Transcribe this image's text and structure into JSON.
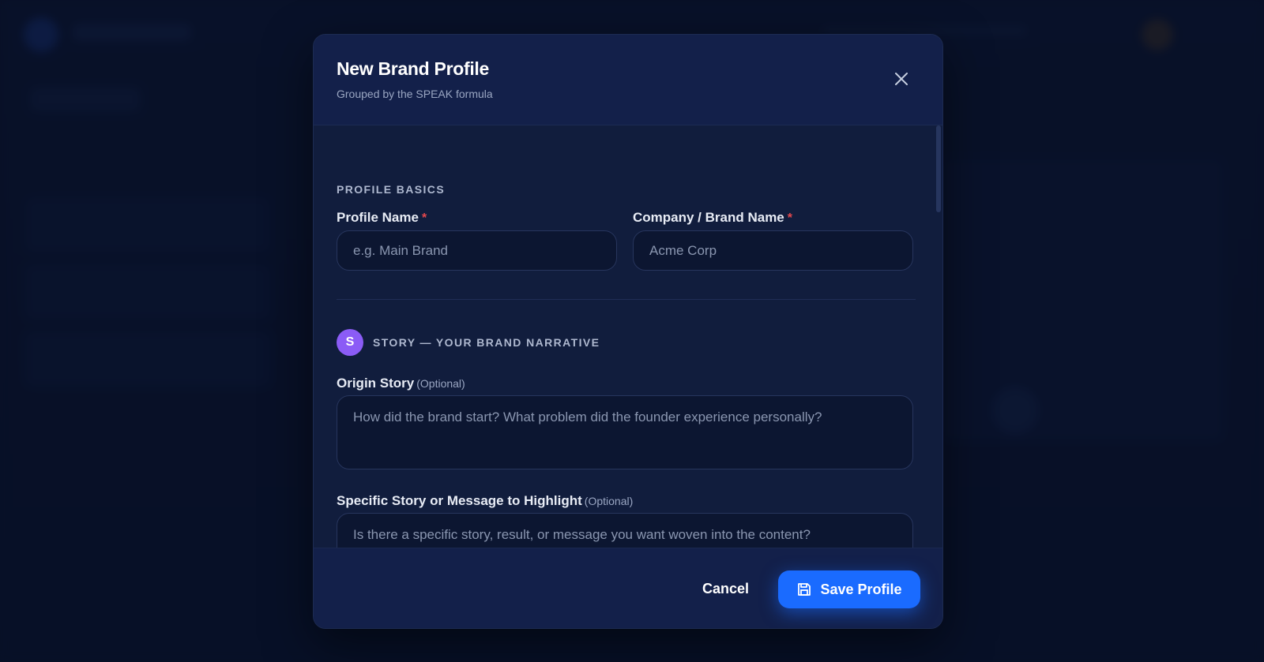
{
  "modal": {
    "title": "New Brand Profile",
    "subtitle": "Grouped by the SPEAK formula",
    "close_icon": "close-icon"
  },
  "basics": {
    "section_label": "PROFILE BASICS",
    "profile_name": {
      "label": "Profile Name",
      "required": "*",
      "placeholder": "e.g. Main Brand",
      "value": ""
    },
    "company_name": {
      "label": "Company / Brand Name",
      "required": "*",
      "placeholder": "Acme Corp",
      "value": ""
    }
  },
  "story": {
    "badge": "S",
    "badge_color": "#8b5cf6",
    "section_label": "STORY — YOUR BRAND NARRATIVE",
    "origin": {
      "label": "Origin Story",
      "optional": "(Optional)",
      "placeholder": "How did the brand start? What problem did the founder experience personally?"
    },
    "specific": {
      "label": "Specific Story or Message to Highlight",
      "optional": "(Optional)",
      "placeholder": "Is there a specific story, result, or message you want woven into the content?"
    }
  },
  "footer": {
    "cancel_label": "Cancel",
    "save_label": "Save Profile",
    "save_icon": "save-icon",
    "accent_color": "#1a6bff"
  }
}
